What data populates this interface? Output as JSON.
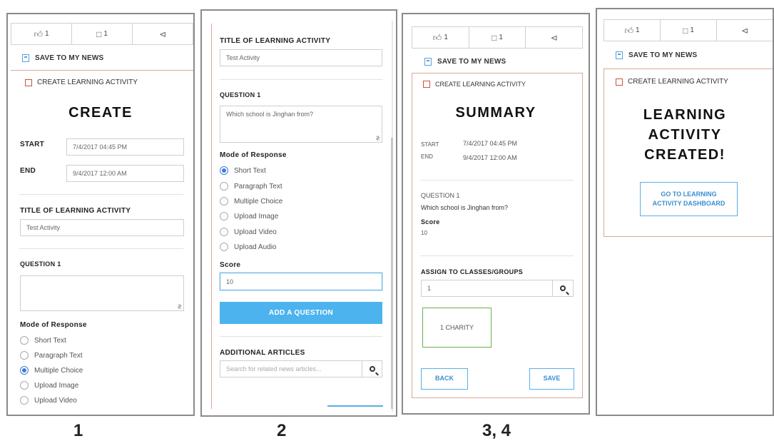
{
  "toolbar": {
    "likes": "1",
    "comments": "1"
  },
  "save_label": "SAVE TO MY NEWS",
  "create_label": "CREATE LEARNING ACTIVITY",
  "screen1": {
    "title": "CREATE",
    "start_label": "START",
    "start_value": "7/4/2017 04:45 PM",
    "end_label": "END",
    "end_value": "9/4/2017 12:00 AM",
    "activity_title_label": "TITLE OF LEARNING ACTIVITY",
    "activity_title_value": "Test Activity",
    "question_label": "QUESTION 1",
    "mode_label": "Mode of Response",
    "options": [
      "Short Text",
      "Paragraph Text",
      "Multiple Choice",
      "Upload Image",
      "Upload Video"
    ],
    "selected_index": 2
  },
  "screen2": {
    "activity_title_label": "TITLE OF LEARNING ACTIVITY",
    "activity_title_value": "Test Activity",
    "question_label": "QUESTION 1",
    "question_value": "Which school is Jinghan from?",
    "mode_label": "Mode of Response",
    "options": [
      "Short Text",
      "Paragraph Text",
      "Multiple Choice",
      "Upload Image",
      "Upload Video",
      "Upload Audio"
    ],
    "selected_index": 0,
    "score_label": "Score",
    "score_value": "10",
    "add_question_label": "ADD A QUESTION",
    "articles_label": "ADDITIONAL ARTICLES",
    "articles_placeholder": "Search for related news articles..."
  },
  "screen3": {
    "title": "SUMMARY",
    "start_label": "START",
    "start_value": "7/4/2017 04:45 PM",
    "end_label": "END",
    "end_value": "9/4/2017 12:00 AM",
    "question_label": "QUESTION 1",
    "question_value": "Which school is Jinghan from?",
    "score_label": "Score",
    "score_value": "10",
    "assign_label": "ASSIGN TO CLASSES/GROUPS",
    "assign_value": "1",
    "group_chip": "1 CHARITY",
    "back_label": "BACK",
    "save_button_label": "SAVE"
  },
  "screen4": {
    "title_line1": "LEARNING",
    "title_line2": "ACTIVITY",
    "title_line3": "CREATED!",
    "dashboard_line1": "GO TO LEARNING",
    "dashboard_line2": "ACTIVITY DASHBOARD"
  },
  "captions": {
    "c1": "1",
    "c2": "2",
    "c3": "3, 4"
  },
  "colors": {
    "accent_blue": "#4db3ee",
    "panel_border": "#d9a79c",
    "chip_green": "#6ab04c"
  }
}
